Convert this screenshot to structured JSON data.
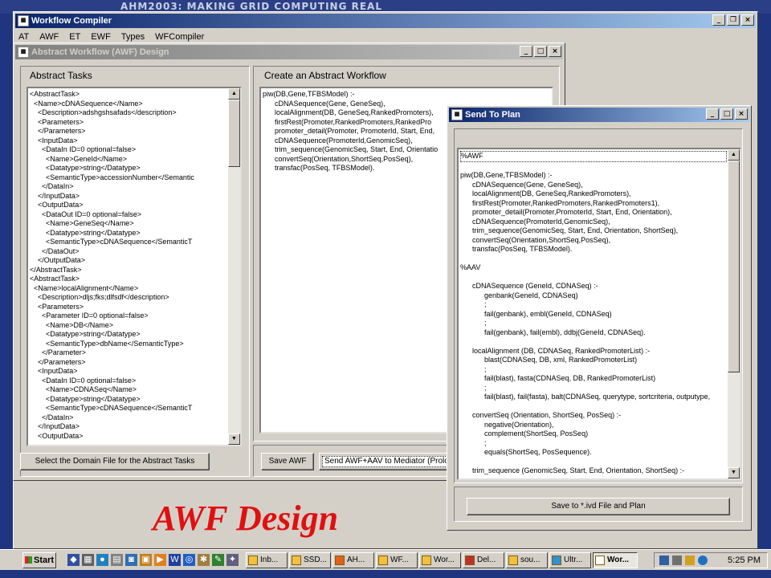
{
  "banner": {
    "text": "AHM2003: MAKING GRID COMPUTING REAL"
  },
  "main_window": {
    "title": "Workflow Compiler",
    "menu": [
      "AT",
      "AWF",
      "ET",
      "EWF",
      "Types",
      "WFCompiler"
    ]
  },
  "awf_window": {
    "title": "Abstract Workflow (AWF) Design",
    "abstract_tasks": {
      "heading": "Abstract Tasks",
      "lines": [
        "<AbstractTask>",
        "  <Name>cDNASequence</Name>",
        "    <Description>adshgshsafads</description>",
        "    <Parameters>",
        "    </Parameters>",
        "    <InputData>",
        "      <DataIn ID=0 optional=false>",
        "        <Name>GeneId</Name>",
        "        <Datatype>string</Datatype>",
        "        <SemanticType>accessionNumber</Semantic",
        "      </DataIn>",
        "    </InputData>",
        "    <OutputData>",
        "      <DataOut ID=0 optional=false>",
        "        <Name>GeneSeq</Name>",
        "        <Datatype>string</Datatype>",
        "        <SemanticType>cDNASequence</SemanticT",
        "      </DataOut>",
        "    </OutputData>",
        "</AbstractTask>",
        "<AbstractTask>",
        "  <Name>localAlignment</Name>",
        "    <Description>dljs;fks;dlfsdf</description>",
        "    <Parameters>",
        "      <Parameter ID=0 optional=false>",
        "        <Name>DB</Name>",
        "        <Datatype>string</Datatype>",
        "        <SemanticType>dbName</SemanticType>",
        "      </Parameter>",
        "    </Parameters>",
        "    <InputData>",
        "      <DataIn ID=0 optional=false>",
        "        <Name>CDNASeq</Name>",
        "        <Datatype>string</Datatype>",
        "        <SemanticType>cDNASequence</SemanticT",
        "      </DataIn>",
        "    </InputData>",
        "    <OutputData>"
      ],
      "button": "Select the Domain File for the Abstract Tasks"
    },
    "create": {
      "heading": "Create an Abstract Workflow",
      "lines": [
        "piw(DB,Gene,TFBSModel) :-",
        "      cDNASequence(Gene, GeneSeq),",
        "      localAlignment(DB, GeneSeq,RankedPromoters),",
        "      firstRest(Promoter,RankedPromoters,RankedPro",
        "      promoter_detail(Promoter, PromoterId, Start, End,",
        "      cDNASequence(PromoterId,GenomicSeq),",
        "      trim_sequence(GenomicSeq, Start, End, Orientatio",
        "      convertSeq(Orientation,ShortSeq,PosSeq),",
        "      transfac(PosSeq, TFBSModel)."
      ],
      "save_button": "Save AWF",
      "send_button": "Send AWF+AAV to Mediator (Prolog"
    }
  },
  "send_window": {
    "title": "Send To Plan",
    "lines": [
      "%AWF",
      "",
      "piw(DB,Gene,TFBSModel) :-",
      "      cDNASequence(Gene, GeneSeq),",
      "      localAlignment(DB, GeneSeq,RankedPromoters),",
      "      firstRest(Promoter,RankedPromoters,RankedPromoters1),",
      "      promoter_detail(Promoter,PromoterId, Start, End, Orientation),",
      "      cDNASequence(PromoterId,GenomicSeq),",
      "      trim_sequence(GenomicSeq, Start, End, Orientation, ShortSeq),",
      "      convertSeq(Orientation,ShortSeq,PosSeq),",
      "      transfac(PosSeq, TFBSModel).",
      "",
      "%AAV",
      "",
      "      cDNASequence (GeneId, CDNASeq) :-",
      "            genbank(GeneId, CDNASeq)",
      "            ;",
      "            fail(genbank), embl(GeneId, CDNASeq)",
      "            ;",
      "            fail(genbank), fail(embl), ddbj(GeneId, CDNASeq).",
      "",
      "      localAlignment (DB, CDNASeq, RankedPromoterList) :-",
      "            blast(CDNASeq, DB, xml, RankedPromoterList)",
      "            ;",
      "            fail(blast), fasta(CDNASeq, DB, RankedPromoterList)",
      "            ;",
      "            fail(blast), fail(fasta), balt(CDNASeq, querytype, sortcriteria, outputype,",
      "",
      "      convertSeq (Orientation, ShortSeq, PosSeq) :-",
      "            negative(Orientation),",
      "            complement(ShortSeq, PosSeq)",
      "            ;",
      "            equals(ShortSeq, PosSequence).",
      "",
      "      trim_sequence (GenomicSeq, Start, End, Orientation, ShortSeq) :-"
    ],
    "button": "Save to *.ivd File and Plan"
  },
  "slide_caption": "AWF Design",
  "taskbar": {
    "start": "Start",
    "tasks": [
      "Inb...",
      "SSD...",
      "AH...",
      "WF...",
      "Wor...",
      "Del...",
      "sou...",
      "Ultr...",
      "Wor..."
    ],
    "clock": "5:25 PM"
  }
}
